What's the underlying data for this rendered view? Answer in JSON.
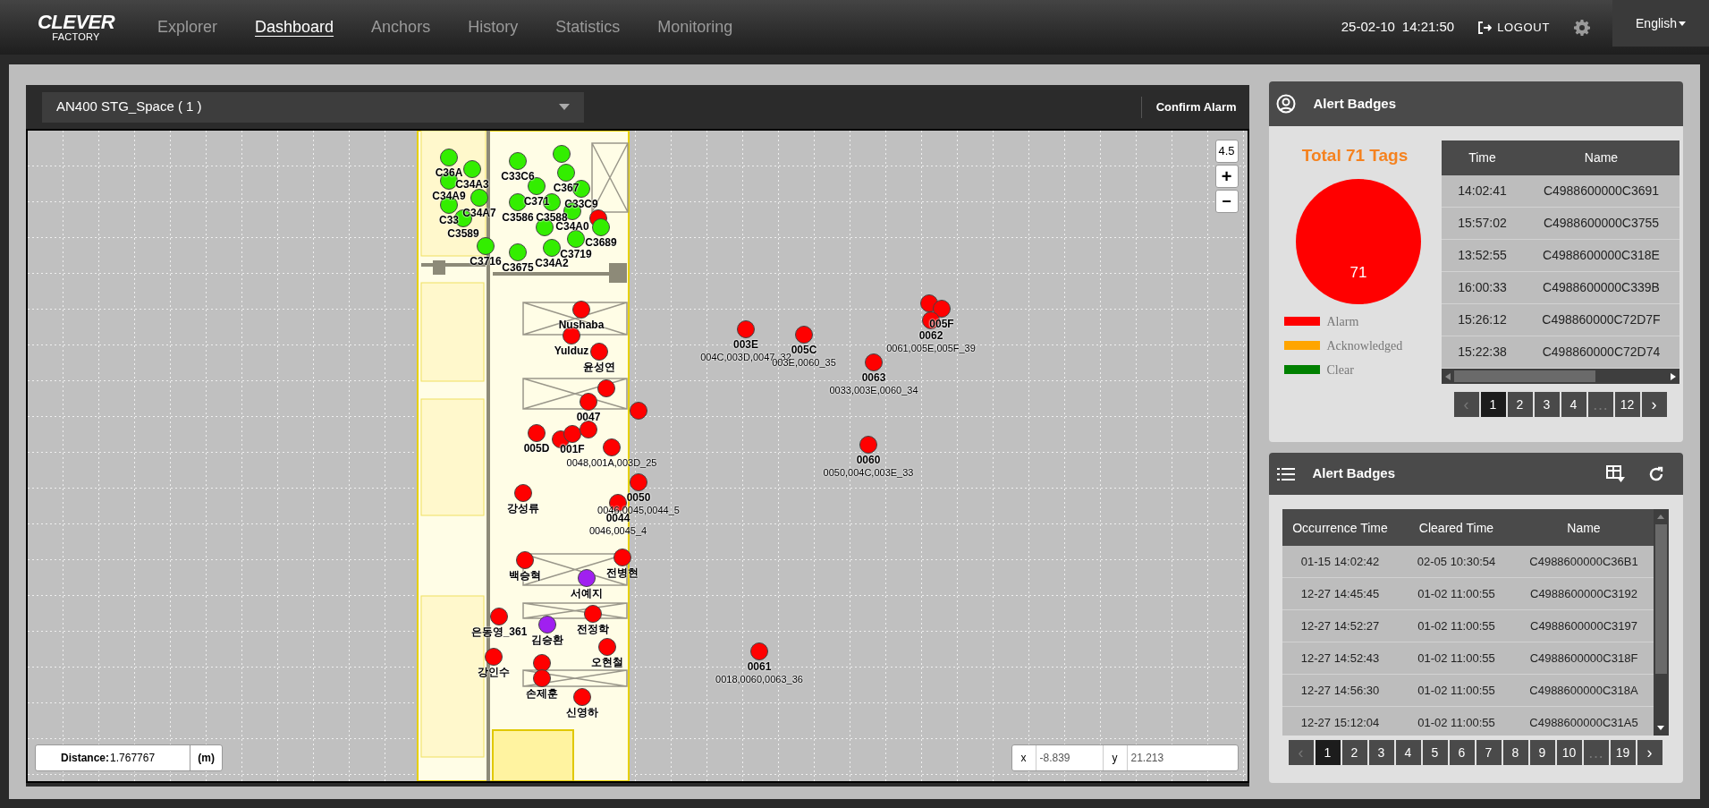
{
  "nav": {
    "logo_top": "CLEVER",
    "logo_bottom": "FACTORY",
    "items": [
      {
        "label": "Explorer",
        "selected": false
      },
      {
        "label": "Dashboard",
        "selected": true
      },
      {
        "label": "Anchors",
        "selected": false
      },
      {
        "label": "History",
        "selected": false
      },
      {
        "label": "Statistics",
        "selected": false
      },
      {
        "label": "Monitoring",
        "selected": false
      }
    ],
    "date": "25-02-10",
    "time": "14:21:50",
    "logout": "LOGOUT",
    "language": "English"
  },
  "map_panel": {
    "space_select": "AN400 STG_Space ( 1 )",
    "confirm_button": "Confirm Alarm",
    "zoom_level": "4.5",
    "zoom_in": "+",
    "zoom_out": "−",
    "tags": [
      {
        "label": "C36A",
        "color": "#33ee00"
      },
      {
        "label": "C34A3",
        "color": "#33ee00"
      },
      {
        "label": "C34A9",
        "color": "#33ee00"
      },
      {
        "label": "C34A7",
        "color": "#33ee00"
      },
      {
        "label": "C33",
        "color": "#33ee00"
      },
      {
        "label": "C3589",
        "color": "#33ee00"
      },
      {
        "label": "C3716",
        "color": "#33ee00"
      },
      {
        "label": "C33C6",
        "color": "#33ee00"
      },
      {
        "color": "#33ee00"
      },
      {
        "label": "C367",
        "color": "#33ee00"
      },
      {
        "label": "C371",
        "color": "#33ee00"
      },
      {
        "label": "C33C9",
        "color": "#33ee00"
      },
      {
        "label": "C3586",
        "color": "#33ee00"
      },
      {
        "label": "C3588",
        "color": "#33ee00"
      },
      {
        "label": "C34A0",
        "color": "#33ee00"
      },
      {
        "color": "#ff0000"
      },
      {
        "label": "C3689",
        "color": "#33ee00"
      },
      {
        "color": "#33ee00"
      },
      {
        "label": "C3719",
        "color": "#33ee00"
      },
      {
        "label": "C34A2",
        "color": "#33ee00"
      },
      {
        "label": "C3675",
        "color": "#33ee00"
      },
      {
        "label": "Nushaba",
        "color": "#ff0000"
      },
      {
        "label": "Yulduz",
        "color": "#ff0000"
      },
      {
        "label": "윤성연",
        "color": "#ff0000"
      },
      {
        "color": "#ff0000"
      },
      {
        "label": "0047",
        "color": "#ff0000"
      },
      {
        "color": "#ff0000"
      },
      {
        "label": "005D",
        "color": "#ff0000"
      },
      {
        "color": "#ff0000"
      },
      {
        "label": "001F",
        "color": "#ff0000"
      },
      {
        "sublabel": "0048,001A,003D_25",
        "color": "#ff0000"
      },
      {
        "color": "#ff0000"
      },
      {
        "label": "강성류",
        "color": "#ff0000"
      },
      {
        "label": "0050",
        "sublabel": "0046,0045,0044_5",
        "color": "#ff0000"
      },
      {
        "label": "0044",
        "sublabel": "0046,0045_4",
        "color": "#ff0000"
      },
      {
        "label": "전병현",
        "color": "#ff0000"
      },
      {
        "label": "서예지",
        "color": "#a020f0"
      },
      {
        "label": "백승혁",
        "color": "#ff0000"
      },
      {
        "label": "전정학",
        "color": "#ff0000"
      },
      {
        "label": "김승환",
        "color": "#a020f0"
      },
      {
        "label": "은동영_361",
        "color": "#ff0000"
      },
      {
        "label": "오현철",
        "color": "#ff0000"
      },
      {
        "label": "강인수",
        "color": "#ff0000"
      },
      {
        "color": "#ff0000"
      },
      {
        "label": "손제훈",
        "color": "#ff0000"
      },
      {
        "label": "신영하",
        "color": "#ff0000"
      },
      {
        "label": "003E",
        "sublabel": "004C,003D,0047_32",
        "color": "#ff0000"
      },
      {
        "label": "005C",
        "sublabel": "003E,0060_35",
        "color": "#ff0000"
      },
      {
        "label": "0063",
        "sublabel": "0033,003E,0060_34",
        "color": "#ff0000"
      },
      {
        "label": "0060",
        "sublabel": "0050,004C,003E_33",
        "color": "#ff0000"
      },
      {
        "label": "0061",
        "sublabel": "0018,0060,0063_36",
        "color": "#ff0000"
      },
      {
        "color": "#ff0000"
      },
      {
        "label": "005F",
        "color": "#ff0000"
      },
      {
        "label": "0062",
        "sublabel": "0061,005E,005F_39",
        "color": "#ff0000"
      }
    ],
    "distance": {
      "label": "Distance:",
      "value": "1.767767",
      "unit": "(m)"
    },
    "cursor": {
      "x_label": "x",
      "x_value": "-8.839",
      "y_label": "y",
      "y_value": "21.213"
    }
  },
  "alert_summary": {
    "title": "Alert Badges",
    "total": "Total 71 Tags",
    "chart_data": {
      "type": "pie",
      "categories": [
        "Alarm",
        "Acknowledged",
        "Clear"
      ],
      "values": [
        71,
        0,
        0
      ],
      "data_labels": true
    },
    "legend": [
      {
        "color": "#ff0000"
      },
      {
        "color": "#ffa500"
      },
      {
        "color": "#008000"
      }
    ],
    "table": {
      "columns": [
        "Time",
        "Name"
      ],
      "rows": [
        [
          "14:02:41",
          "C4988600000C3691"
        ],
        [
          "15:57:02",
          "C4988600000C3755"
        ],
        [
          "13:52:55",
          "C4988600000C318E"
        ],
        [
          "16:00:33",
          "C4988600000C339B"
        ],
        [
          "15:26:12",
          "C498860000C72D7F"
        ],
        [
          "15:22:38",
          "C498860000C72D74"
        ]
      ]
    },
    "pagination": [
      {
        "kind": "prev",
        "label": "‹",
        "selected": false,
        "disabled": true
      },
      {
        "kind": "page",
        "label": "1",
        "selected": true,
        "disabled": false
      },
      {
        "kind": "page",
        "label": "2",
        "selected": false,
        "disabled": false
      },
      {
        "kind": "page",
        "label": "3",
        "selected": false,
        "disabled": false
      },
      {
        "kind": "page",
        "label": "4",
        "selected": false,
        "disabled": false
      },
      {
        "kind": "gap",
        "label": "…",
        "selected": false,
        "disabled": true
      },
      {
        "kind": "page",
        "label": "12",
        "selected": false,
        "disabled": false
      },
      {
        "kind": "next",
        "label": "›",
        "selected": false,
        "disabled": false
      }
    ]
  },
  "alert_history": {
    "title": "Alert Badges",
    "table": {
      "columns": [
        "Occurrence Time",
        "Cleared Time",
        "Name"
      ],
      "rows": [
        [
          "01-15 14:02:42",
          "02-05 10:30:54",
          "C4988600000C36B1"
        ],
        [
          "12-27 14:45:45",
          "01-02 11:00:55",
          "C4988600000C3192"
        ],
        [
          "12-27 14:52:27",
          "01-02 11:00:55",
          "C4988600000C3197"
        ],
        [
          "12-27 14:52:43",
          "01-02 11:00:55",
          "C4988600000C318F"
        ],
        [
          "12-27 14:56:30",
          "01-02 11:00:55",
          "C4988600000C318A"
        ],
        [
          "12-27 15:12:04",
          "01-02 11:00:55",
          "C4988600000C31A5"
        ]
      ]
    },
    "pagination": [
      {
        "kind": "prev",
        "label": "‹",
        "selected": false,
        "disabled": true
      },
      {
        "kind": "page",
        "label": "1",
        "selected": true,
        "disabled": false
      },
      {
        "kind": "page",
        "label": "2",
        "selected": false,
        "disabled": false
      },
      {
        "kind": "page",
        "label": "3",
        "selected": false,
        "disabled": false
      },
      {
        "kind": "page",
        "label": "4",
        "selected": false,
        "disabled": false
      },
      {
        "kind": "page",
        "label": "5",
        "selected": false,
        "disabled": false
      },
      {
        "kind": "page",
        "label": "6",
        "selected": false,
        "disabled": false
      },
      {
        "kind": "page",
        "label": "7",
        "selected": false,
        "disabled": false
      },
      {
        "kind": "page",
        "label": "8",
        "selected": false,
        "disabled": false
      },
      {
        "kind": "page",
        "label": "9",
        "selected": false,
        "disabled": false
      },
      {
        "kind": "page",
        "label": "10",
        "selected": false,
        "disabled": false
      },
      {
        "kind": "gap",
        "label": "…",
        "selected": false,
        "disabled": true
      },
      {
        "kind": "page",
        "label": "19",
        "selected": false,
        "disabled": false
      },
      {
        "kind": "next",
        "label": "›",
        "selected": false,
        "disabled": false
      }
    ]
  }
}
